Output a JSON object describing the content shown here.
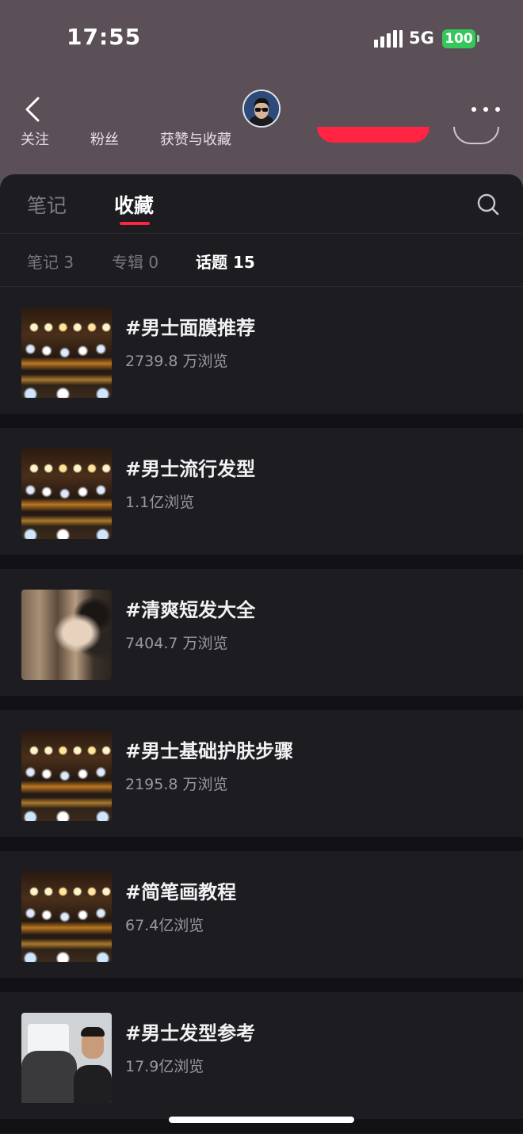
{
  "status_bar": {
    "time": "17:55",
    "network": "5G",
    "battery": "100",
    "battery_color": "#34c759"
  },
  "header": {
    "stats": {
      "following_label": "关注",
      "fans_label": "粉丝",
      "likes_label": "获赞与收藏"
    },
    "accent_color": "#ff2442"
  },
  "main_tabs": [
    {
      "label": "笔记",
      "active": false
    },
    {
      "label": "收藏",
      "active": true
    }
  ],
  "sub_tabs": [
    {
      "label": "笔记 3",
      "active": false
    },
    {
      "label": "专辑 0",
      "active": false
    },
    {
      "label": "话题 15",
      "active": true
    }
  ],
  "topics": [
    {
      "title": "#男士面膜推荐",
      "views": "2739.8 万浏览",
      "thumb": "lights"
    },
    {
      "title": "#男士流行发型",
      "views": "1.1亿浏览",
      "thumb": "lights"
    },
    {
      "title": "#清爽短发大全",
      "views": "7404.7 万浏览",
      "thumb": "hand"
    },
    {
      "title": "#男士基础护肤步骤",
      "views": "2195.8 万浏览",
      "thumb": "lights"
    },
    {
      "title": "#简笔画教程",
      "views": "67.4亿浏览",
      "thumb": "lights"
    },
    {
      "title": "#男士发型参考",
      "views": "17.9亿浏览",
      "thumb": "man"
    }
  ],
  "icons": {
    "back": "chevron-left-icon",
    "more": "more-dots-icon",
    "search": "search-icon"
  }
}
